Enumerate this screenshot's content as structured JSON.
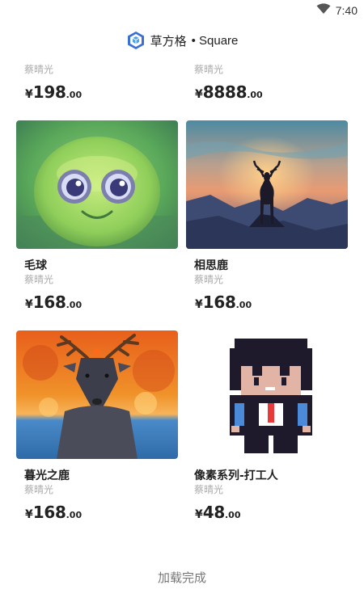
{
  "status": {
    "time": "7:40",
    "wifi_icon": "wifi-icon"
  },
  "header": {
    "title": "草方格",
    "subtitle": "• Square",
    "logo_icon": "cube-logo-icon"
  },
  "top_row": [
    {
      "author": "蔡晴光",
      "currency": "¥",
      "price_int": "198",
      "price_dec": ".00"
    },
    {
      "author": "蔡晴光",
      "currency": "¥",
      "price_int": "8888",
      "price_dec": ".00"
    }
  ],
  "cards": [
    {
      "title": "毛球",
      "author": "蔡晴光",
      "currency": "¥",
      "price_int": "168",
      "price_dec": ".00",
      "image": "green-fluffball"
    },
    {
      "title": "相思鹿",
      "author": "蔡晴光",
      "currency": "¥",
      "price_int": "168",
      "price_dec": ".00",
      "image": "deer-sunset"
    },
    {
      "title": "暮光之鹿",
      "author": "蔡晴光",
      "currency": "¥",
      "price_int": "168",
      "price_dec": ".00",
      "image": "deer-twilight"
    },
    {
      "title": "像素系列-打工人",
      "author": "蔡晴光",
      "currency": "¥",
      "price_int": "48",
      "price_dec": ".00",
      "image": "pixel-worker"
    }
  ],
  "footer": {
    "text": "加载完成"
  }
}
